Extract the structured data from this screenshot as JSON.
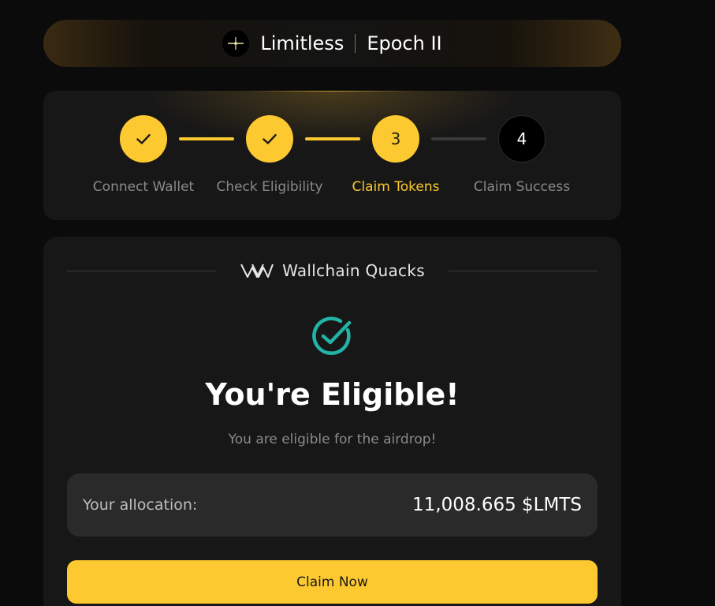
{
  "header": {
    "brand": "Limitless",
    "epoch": "Epoch II"
  },
  "steps": [
    {
      "label": "Connect Wallet",
      "state": "done",
      "number": ""
    },
    {
      "label": "Check Eligibility",
      "state": "done",
      "number": ""
    },
    {
      "label": "Claim Tokens",
      "state": "active",
      "number": "3"
    },
    {
      "label": "Claim Success",
      "state": "todo",
      "number": "4"
    }
  ],
  "card": {
    "partner": "Wallchain Quacks",
    "title": "You're Eligible!",
    "subtitle": "You are eligible for the airdrop!",
    "allocation_label": "Your allocation:",
    "allocation_value": "11,008.665 $LMTS",
    "claim_label": "Claim Now"
  },
  "colors": {
    "accent": "#fcc930",
    "success": "#22b3a6",
    "background": "#0b0b0b",
    "card": "#171717"
  }
}
